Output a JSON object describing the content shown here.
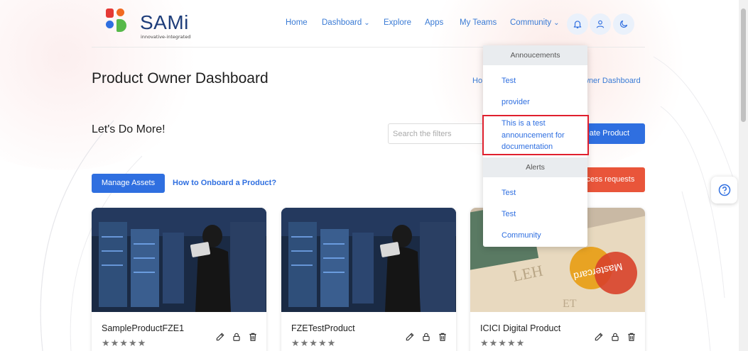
{
  "brand": {
    "name": "SAMi",
    "tagline": "innovative-integrated",
    "colors": {
      "orange": "#f26a21",
      "red": "#e53935",
      "blue": "#2f6fe0",
      "green": "#57b94a"
    }
  },
  "nav": {
    "home": "Home",
    "dashboard": "Dashboard",
    "explore": "Explore",
    "apps": "Apps",
    "my_teams": "My Teams",
    "community": "Community"
  },
  "header_icons": [
    "bell-icon",
    "user-icon",
    "moon-icon"
  ],
  "page": {
    "title": "Product Owner Dashboard",
    "breadcrumb_home": "Ho",
    "breadcrumb_current": "wner Dashboard",
    "tagline": "Let's Do More!",
    "search_placeholder": "Search the filters",
    "create_button": "reate Product",
    "manage_assets": "Manage Assets",
    "onboard_link": "How to Onboard a Product?",
    "access_requests": "ccess requests"
  },
  "cards": [
    {
      "title": "SampleProductFZE1",
      "stars": "★★★★★"
    },
    {
      "title": "FZETestProduct",
      "stars": "★★★★★"
    },
    {
      "title": "ICICI Digital Product",
      "stars": "★★★★★"
    }
  ],
  "community_dropdown": {
    "announcements_header": "Annoucements",
    "announcements": [
      "Test",
      "provider",
      "This is a test announcement for documentation"
    ],
    "alerts_header": "Alerts",
    "alerts": [
      "Test",
      "Test",
      "Community"
    ]
  },
  "accent_color": "#2f6fe0",
  "danger_color": "#e9553a"
}
